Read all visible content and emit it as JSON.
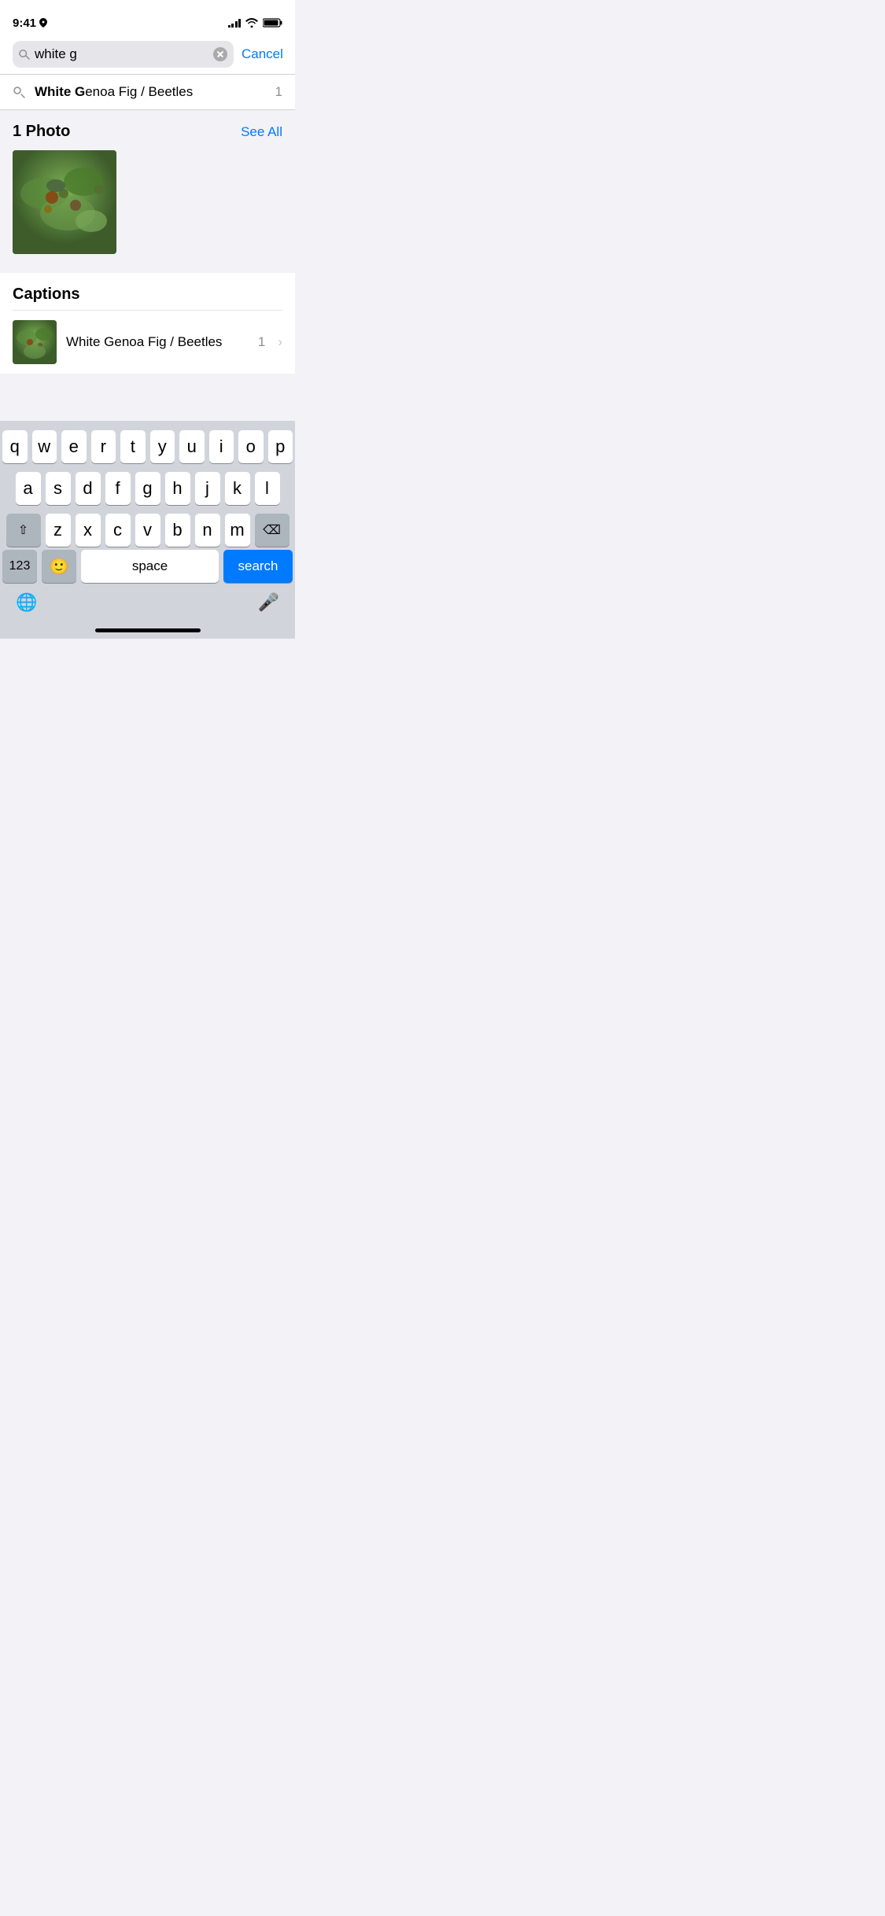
{
  "statusBar": {
    "time": "9:41",
    "hasLocation": true
  },
  "searchBar": {
    "query": "white g",
    "placeholder": "Search",
    "cancelLabel": "Cancel"
  },
  "suggestion": {
    "text": "White Genoa Fig / Beetles",
    "count": "1"
  },
  "photosSection": {
    "title": "1 Photo",
    "seeAllLabel": "See All"
  },
  "captionsSection": {
    "title": "Captions",
    "item": {
      "text": "White Genoa Fig / Beetles",
      "count": "1"
    }
  },
  "keyboard": {
    "row1": [
      "q",
      "w",
      "e",
      "r",
      "t",
      "y",
      "u",
      "i",
      "o",
      "p"
    ],
    "row2": [
      "a",
      "s",
      "d",
      "f",
      "g",
      "h",
      "j",
      "k",
      "l"
    ],
    "row3": [
      "z",
      "x",
      "c",
      "v",
      "b",
      "n",
      "m"
    ],
    "spaceLabel": "space",
    "searchLabel": "search",
    "numbersLabel": "123"
  }
}
